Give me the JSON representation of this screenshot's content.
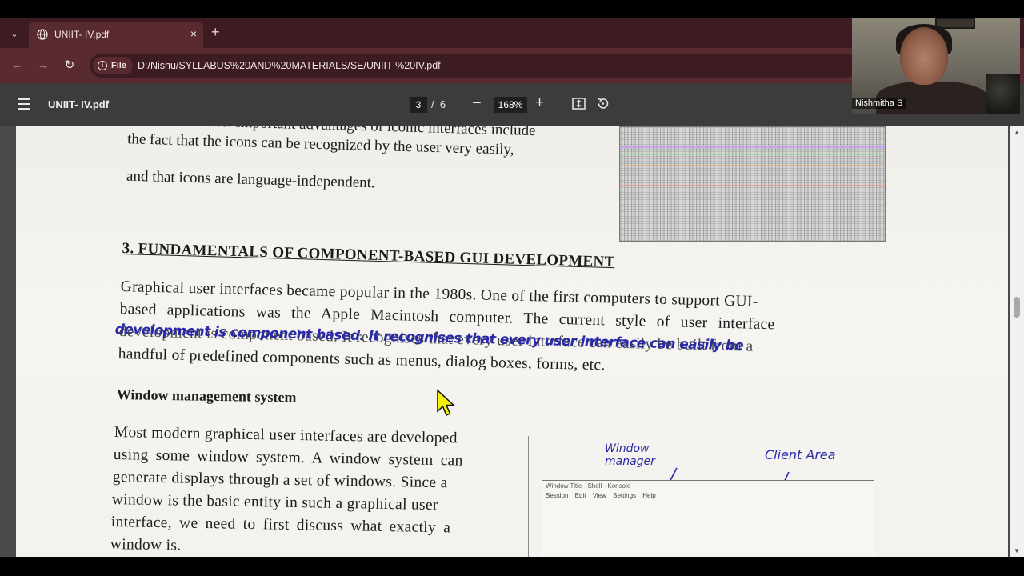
{
  "browser": {
    "tab_title": "UNIIT- IV.pdf",
    "tab_close_glyph": "×",
    "new_tab_glyph": "+",
    "tab_list_glyph": "⌄",
    "back_glyph": "←",
    "forward_glyph": "→",
    "reload_glyph": "↻",
    "file_chip_label": "File",
    "url": "D:/Nishu/SYLLABUS%20AND%20MATERIALS/SE/UNIIT-%20IV.pdf"
  },
  "pdf_toolbar": {
    "title": "UNIIT- IV.pdf",
    "current_page": "3",
    "page_separator": "/",
    "total_pages": "6",
    "zoom": "168%",
    "zoom_out_glyph": "−",
    "zoom_in_glyph": "+"
  },
  "document": {
    "paragraph_top": [
      "iconic interfaces. Important advantages of iconic interfaces include",
      "the fact that the icons can be recognized by the user very easily,",
      "and that icons are language-independent."
    ],
    "section_heading": "3. FUNDAMENTALS OF COMPONENT-BASED GUI DEVELOPMENT",
    "section_paragraph": [
      "Graphical user interfaces became popular in the 1980s. One of the first computers to support GUI-",
      "based applications was the Apple Macintosh computer. The current style of user interface",
      "development is component based. It recognises that every user interface can easily be built from a",
      "handful of predefined components such as menus, dialog boxes, forms, etc."
    ],
    "subheading": "Window management system",
    "subsection_paragraph": [
      "Most modern graphical user interfaces are developed",
      "using some window system. A window system can",
      "generate displays through a set of windows. Since a",
      "window is the basic entity in such a graphical user",
      "interface, we need to first discuss what exactly a",
      "window is."
    ],
    "diagram": {
      "window_title": "Window Title - Shell - Konsole",
      "window_menu": "Session Edit View Settings Help",
      "annotation_manager": "Window manager",
      "annotation_client": "Client Area"
    },
    "handwritten_overlay": "development is component based. It recognises that every user interface can easily be"
  },
  "webcam": {
    "participant_name": "Nishmitha S"
  },
  "scrollbar": {
    "up_glyph": "▲",
    "down_glyph": "▼"
  }
}
